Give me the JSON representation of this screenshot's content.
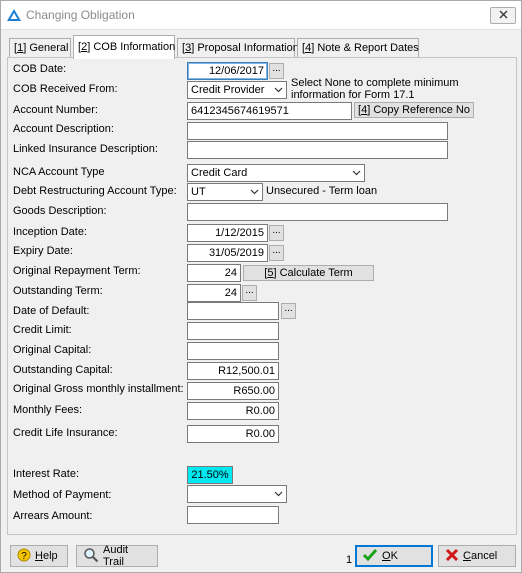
{
  "window": {
    "title": "Changing Obligation"
  },
  "tabs": [
    {
      "key": "1",
      "label": "General"
    },
    {
      "key": "2",
      "label": "COB Information"
    },
    {
      "key": "3",
      "label": "Proposal Information"
    },
    {
      "key": "4",
      "label": "Note & Report Dates"
    }
  ],
  "form": {
    "cob_date": {
      "label": "COB Date:",
      "value": "12/06/2017"
    },
    "cob_received_from": {
      "label": "COB Received From:",
      "value": "Credit Provider",
      "note": "Select None to complete minimum information for Form 17.1"
    },
    "account_number": {
      "label": "Account Number:",
      "value": "6412345674619571",
      "button_key": "4",
      "button_label": "Copy Reference No"
    },
    "account_description": {
      "label": "Account Description:",
      "value": ""
    },
    "linked_insurance_description": {
      "label": "Linked Insurance Description:",
      "value": ""
    },
    "nca_account_type": {
      "label": "NCA Account Type",
      "value": "Credit Card"
    },
    "debt_restructuring_account_type": {
      "label": "Debt Restructuring Account Type:",
      "value": "UT",
      "description": "Unsecured - Term loan"
    },
    "goods_description": {
      "label": "Goods Description:",
      "value": ""
    },
    "inception_date": {
      "label": "Inception Date:",
      "value": "1/12/2015"
    },
    "expiry_date": {
      "label": "Expiry Date:",
      "value": "31/05/2019"
    },
    "original_repayment_term": {
      "label": "Original Repayment Term:",
      "value": "24",
      "button_key": "5",
      "button_label": "Calculate Term"
    },
    "outstanding_term": {
      "label": "Outstanding Term:",
      "value": "24"
    },
    "date_of_default": {
      "label": "Date of Default:",
      "value": ""
    },
    "credit_limit": {
      "label": "Credit Limit:",
      "value": ""
    },
    "original_capital": {
      "label": "Original Capital:",
      "value": ""
    },
    "outstanding_capital": {
      "label": "Outstanding Capital:",
      "value": "R12,500.01"
    },
    "original_gross_monthly_installment": {
      "label": "Original Gross monthly installment:",
      "value": "R650.00"
    },
    "monthly_fees": {
      "label": "Monthly Fees:",
      "value": "R0.00"
    },
    "credit_life_insurance": {
      "label": "Credit Life Insurance:",
      "value": "R0.00"
    },
    "interest_rate": {
      "label": "Interest Rate:",
      "value": "21.50%"
    },
    "method_of_payment": {
      "label": "Method of Payment:",
      "value": ""
    },
    "arrears_amount": {
      "label": "Arrears Amount:",
      "value": ""
    }
  },
  "footer": {
    "help_label": "Help",
    "help_key": "H",
    "audit_trail_label": "Audit Trail",
    "ok_count": "1",
    "ok_label": "OK",
    "ok_key": "O",
    "cancel_label": "Cancel",
    "cancel_key": "C"
  },
  "ellipsis": "...",
  "colors": {
    "interest_highlight": "#00e8f0",
    "focus_border": "#3c7fb1",
    "ok_check": "#1aa31a",
    "cancel_x": "#d01818"
  }
}
